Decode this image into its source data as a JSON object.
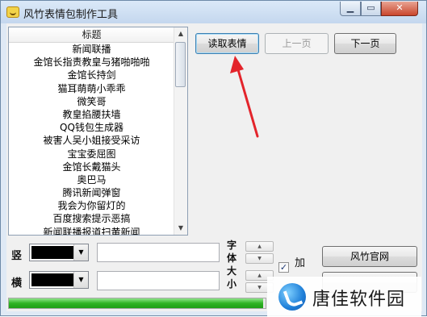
{
  "window": {
    "title": "风竹表情包制作工具",
    "controls": {
      "minimize": "▁",
      "maximize": "▭",
      "close": "✕"
    }
  },
  "list": {
    "header": "标题",
    "items": [
      "新闻联播",
      "金馆长指责教皇与猪啪啪啪",
      "金馆长持剑",
      "猫耳萌萌小乖乖",
      "微笑哥",
      "教皇掐腰扶墙",
      "QQ钱包生成器",
      "被害人吴小姐接受采访",
      "宝宝委屈图",
      "金馆长戴猫头",
      "奥巴马",
      "腾讯新闻弹窗",
      "我会为你留灯的",
      "百度搜索提示恶搞",
      "新闻联播报道扫黄新闻"
    ]
  },
  "buttons": {
    "read": "读取表情",
    "prev": "上一页",
    "next": "下一页",
    "website": "风竹官网"
  },
  "form": {
    "vertical_label": "竖",
    "horizontal_label": "横",
    "font_size_label": "字体大小",
    "add_label": "加"
  },
  "progress": {
    "fraction": 0.99
  },
  "watermark": {
    "text": "唐佳软件园"
  },
  "colors": {
    "arrow": "#e3242b",
    "swatch": "#000000",
    "progress": "#2fb324"
  },
  "icons": {
    "app": "smiley-icon",
    "checkbox": "check-icon"
  }
}
